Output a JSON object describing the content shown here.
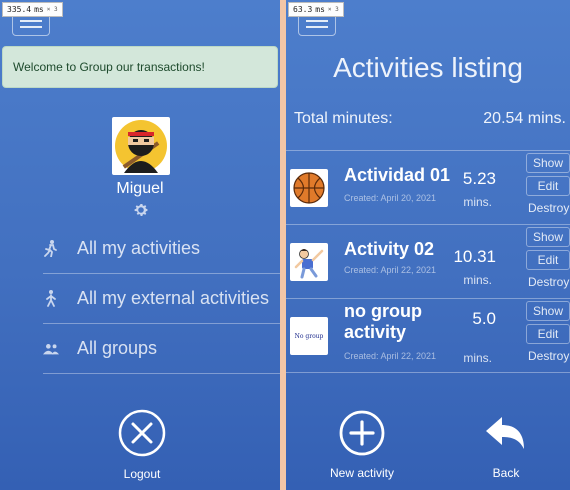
{
  "left_screen": {
    "perf": {
      "time": "335.4",
      "unit": "ms",
      "mult": "× 3"
    },
    "flash": "Welcome to Group our transactions!",
    "user": {
      "name": "Miguel"
    },
    "menu": [
      {
        "label": "All my activities",
        "icon": "person-walk-icon"
      },
      {
        "label": "All my external activities",
        "icon": "person-walk-icon"
      },
      {
        "label": "All groups",
        "icon": "group-icon"
      }
    ],
    "logout_label": "Logout"
  },
  "right_screen": {
    "perf": {
      "time": "63.3",
      "unit": "ms",
      "mult": "× 3"
    },
    "title": "Activities listing",
    "total_label": "Total minutes:",
    "total_value": "20.54 mins.",
    "activities": [
      {
        "name": "Actividad 01",
        "created": "Created: April 20, 2021",
        "minutes": "5.23",
        "unit": "mins.",
        "icon": "basketball-icon"
      },
      {
        "name": "Activity 02",
        "created": "Created: April 22, 2021",
        "minutes": "10.31",
        "unit": "mins.",
        "icon": "stretching-icon"
      },
      {
        "name": "no group activity",
        "created": "Created: April 22, 2021",
        "minutes": "5.0",
        "unit": "mins.",
        "icon": "no-group-thumb",
        "thumb_text": "No group"
      }
    ],
    "row_buttons": {
      "show": "Show",
      "edit": "Edit",
      "destroy": "Destroy"
    },
    "new_activity_label": "New activity",
    "back_label": "Back"
  },
  "colors": {
    "background": "#4270c0",
    "flash_bg": "#d3e7da",
    "flash_text": "#1d4a2c",
    "frame": "#f2c6a7"
  }
}
